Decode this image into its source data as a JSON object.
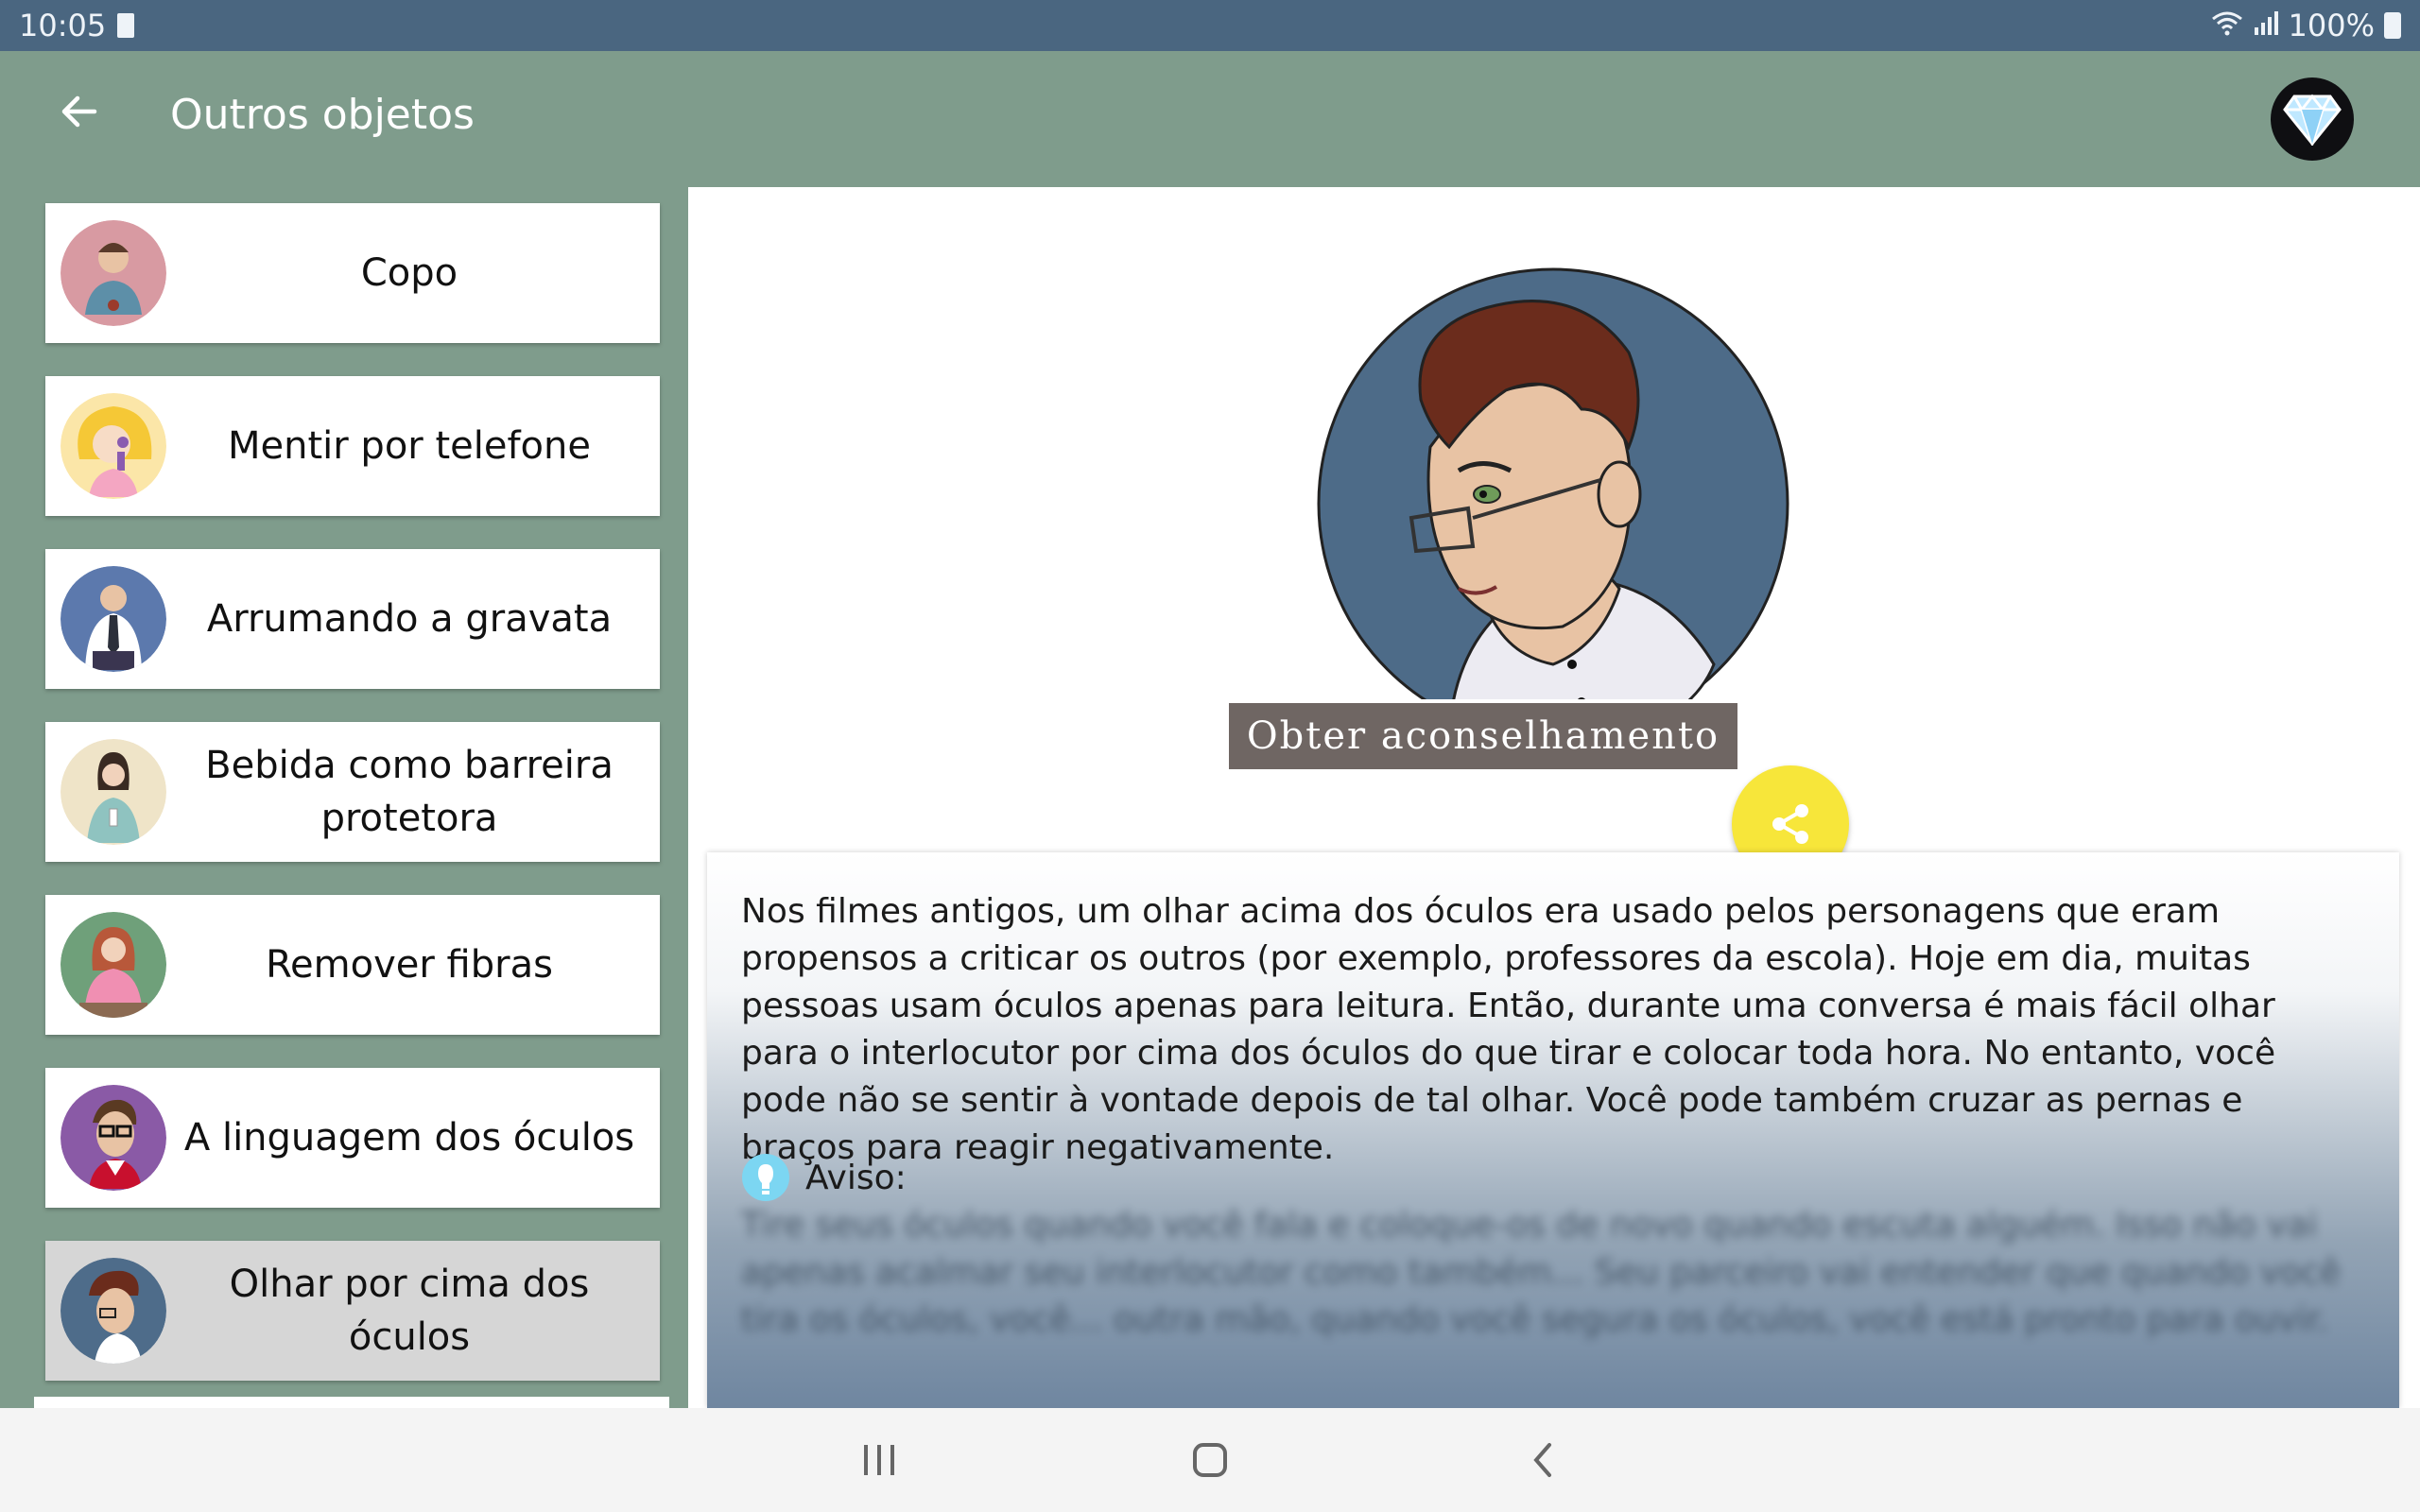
{
  "status": {
    "time": "10:05",
    "battery": "100%"
  },
  "appbar": {
    "title": "Outros objetos"
  },
  "sidebar": {
    "items": [
      {
        "label": "Copo"
      },
      {
        "label": "Mentir por telefone"
      },
      {
        "label": "Arrumando a gravata"
      },
      {
        "label": "Bebida como barreira protetora"
      },
      {
        "label": "Remover fibras"
      },
      {
        "label": "A linguagem dos óculos"
      },
      {
        "label": "Olhar por cima dos óculos"
      }
    ]
  },
  "content": {
    "description": "Nos filmes antigos, um olhar acima dos óculos era usado pelos personagens que eram propensos a criticar os outros (por exemplo, professores da escola). Hoje em dia, muitas pessoas usam óculos apenas para leitura. Então, durante uma conversa é mais fácil olhar para o interlocutor por cima dos óculos do que tirar e colocar toda hora. No entanto, você pode não se sentir à vontade depois de tal olhar. Você pode também cruzar as pernas e braços para reagir negativamente.",
    "tip_label": "Aviso:",
    "tip_blurred": "Tire seus óculos quando você fala e coloque-os de novo quando escuta alguém. Isso não vai apenas acalmar seu interlocutor como também... Seu parceiro vai entender que quando você tira os óculos, você... outra mão, quando você segura os óculos, você está pronto para ouvir.",
    "advice_button": "Obter aconselhamento"
  },
  "colors": {
    "statusbar": "#4a6680",
    "appbar": "#7f9c8c",
    "share": "#f7e63a",
    "advice_button": "#6f6663"
  }
}
